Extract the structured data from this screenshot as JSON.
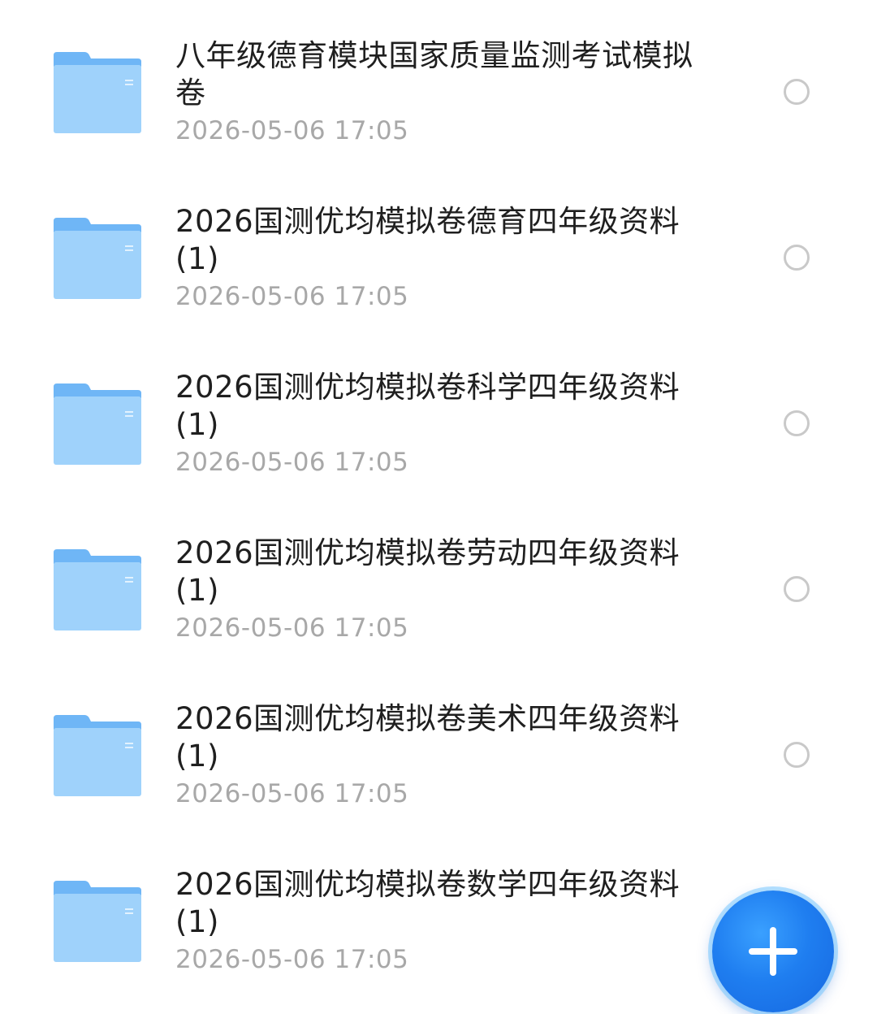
{
  "files": [
    {
      "name": "八年级德育模块国家质量监测考试模拟卷",
      "date": "2026-05-06 17:05"
    },
    {
      "name": "2026国测优均模拟卷德育四年级资料(1)",
      "date": "2026-05-06 17:05"
    },
    {
      "name": "2026国测优均模拟卷科学四年级资料(1)",
      "date": "2026-05-06 17:05"
    },
    {
      "name": "2026国测优均模拟卷劳动四年级资料(1)",
      "date": "2026-05-06 17:05"
    },
    {
      "name": "2026国测优均模拟卷美术四年级资料(1)",
      "date": "2026-05-06 17:05"
    },
    {
      "name": "2026国测优均模拟卷数学四年级资料(1)",
      "date": "2026-05-06 17:05"
    }
  ],
  "icons": {
    "folder": "folder-icon",
    "select": "radio-unchecked-icon",
    "fab": "plus-icon"
  },
  "colors": {
    "folder_light": "#9fd2fb",
    "folder_dark": "#6fb6f6",
    "fab": "#1f7ef0",
    "title_text": "#1f1f1f",
    "date_text": "#a8a8a8"
  }
}
